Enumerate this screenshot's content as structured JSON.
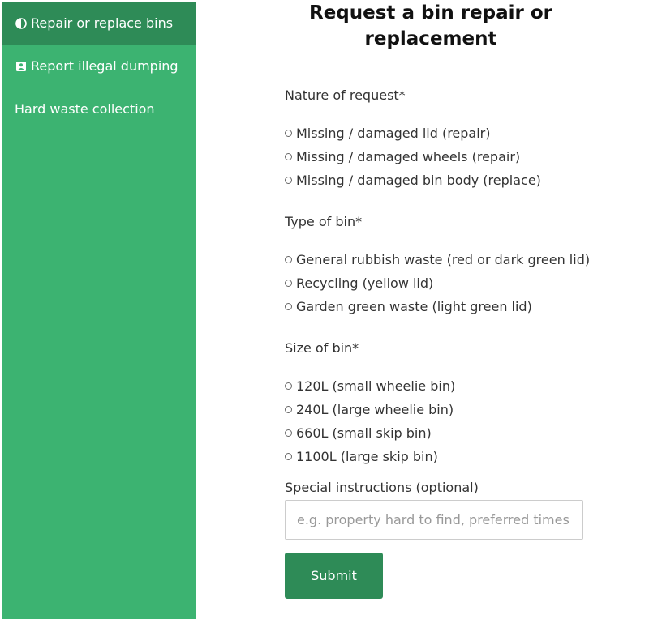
{
  "sidebar": {
    "items": [
      {
        "label": "Repair or replace bins",
        "icon": "half-circle-icon",
        "active": true
      },
      {
        "label": "Report illegal dumping",
        "icon": "contact-card-icon",
        "active": false
      },
      {
        "label": "Hard waste collection",
        "icon": "",
        "active": false
      }
    ]
  },
  "main": {
    "title": "Request a bin repair or replacement",
    "nature": {
      "label": "Nature of request*",
      "options": [
        "Missing / damaged lid (repair)",
        "Missing / damaged wheels (repair)",
        "Missing / damaged bin body (replace)"
      ]
    },
    "bin_type": {
      "label": "Type of bin*",
      "options": [
        "General rubbish waste (red or dark green lid)",
        "Recycling (yellow lid)",
        "Garden green waste (light green lid)"
      ]
    },
    "bin_size": {
      "label": "Size of bin*",
      "options": [
        "120L (small wheelie bin)",
        "240L (large wheelie bin)",
        "660L (small skip bin)",
        "1100L (large skip bin)"
      ]
    },
    "instructions": {
      "label": "Special instructions (optional)",
      "value": "",
      "placeholder": "e.g. property hard to find, preferred times"
    },
    "submit_label": "Submit"
  },
  "colors": {
    "sidebar": "#3cb371",
    "sidebar_active": "#2e8b57",
    "button": "#2e8b57"
  }
}
